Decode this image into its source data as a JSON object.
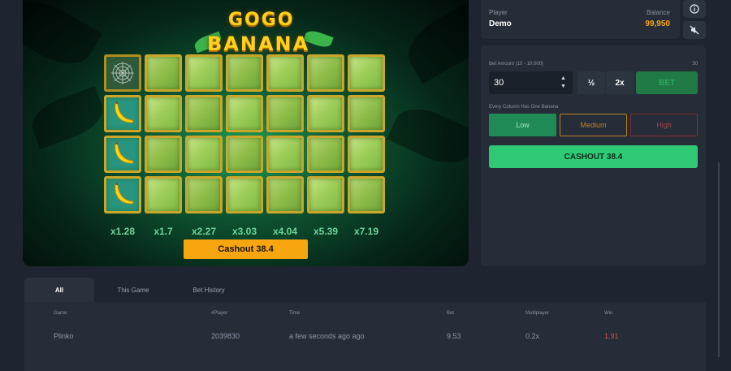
{
  "game": {
    "logo_line1": "GOGO",
    "logo_line2": "BANANA",
    "multipliers": [
      "x1.28",
      "x1.7",
      "x2.27",
      "x3.03",
      "x4.04",
      "x5.39",
      "x7.19"
    ],
    "revealed": [
      {
        "row": 0,
        "col": 0,
        "content": "spider-web"
      },
      {
        "row": 1,
        "col": 0,
        "content": "banana"
      },
      {
        "row": 2,
        "col": 0,
        "content": "banana"
      },
      {
        "row": 3,
        "col": 0,
        "content": "banana"
      }
    ],
    "cashout_label": "Cashout 38.4"
  },
  "account": {
    "player_label": "Player",
    "player_value": "Demo",
    "balance_label": "Balance",
    "balance_value": "99,950"
  },
  "icons": {
    "info": "info-icon",
    "sound": "sound-off-icon"
  },
  "bet": {
    "label": "Bet Amount (10 - 10,000)",
    "right_value": "30",
    "amount": "30",
    "half_label": "½",
    "double_label": "2x",
    "bet_label": "BET"
  },
  "risk": {
    "label": "Every Column Has One Banana",
    "low": "Low",
    "medium": "Medium",
    "high": "High"
  },
  "cashout": {
    "label": "CASHOUT 38.4"
  },
  "history": {
    "tabs": [
      "All",
      "This Game",
      "Bet History"
    ],
    "headers": {
      "game": "Game",
      "player": "#Player",
      "time": "Time",
      "bet": "Bet",
      "multiplier": "Multiplayer",
      "win": "Win"
    },
    "rows": [
      {
        "game": "Plinko",
        "player": "2039830",
        "time": "a few seconds ago ago",
        "bet": "9.53",
        "multiplier": "0.2x",
        "win": "1.91"
      }
    ]
  },
  "colors": {
    "accent_green": "#2fc975",
    "cashout_orange": "#f8a60f",
    "balance_orange": "#f8a60f",
    "win_red": "#e04a4a"
  }
}
